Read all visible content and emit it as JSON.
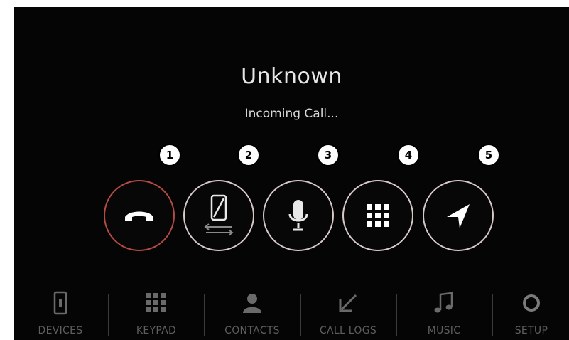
{
  "call": {
    "caller_name": "Unknown",
    "status": "Incoming Call..."
  },
  "callouts": [
    "1",
    "2",
    "3",
    "4",
    "5"
  ],
  "actions": [
    {
      "id": "reject",
      "icon": "phone-hangup-icon"
    },
    {
      "id": "transfer",
      "icon": "phone-transfer-icon"
    },
    {
      "id": "mute",
      "icon": "microphone-icon"
    },
    {
      "id": "keypad",
      "icon": "keypad-grid-icon"
    },
    {
      "id": "navigation",
      "icon": "navigation-arrow-icon"
    }
  ],
  "bottom_tabs": [
    {
      "label": "DEVICES",
      "icon": "device-icon"
    },
    {
      "label": "KEYPAD",
      "icon": "keypad-icon"
    },
    {
      "label": "CONTACTS",
      "icon": "contact-person-icon"
    },
    {
      "label": "CALL LOGS",
      "icon": "call-log-arrow-icon"
    },
    {
      "label": "MUSIC",
      "icon": "music-note-icon"
    },
    {
      "label": "SETUP",
      "icon": "gear-icon"
    }
  ],
  "colors": {
    "background": "#050505",
    "reject_ring": "#b54a45",
    "button_ring": "#d8c8c8",
    "tab_text": "#5e5e5e"
  }
}
